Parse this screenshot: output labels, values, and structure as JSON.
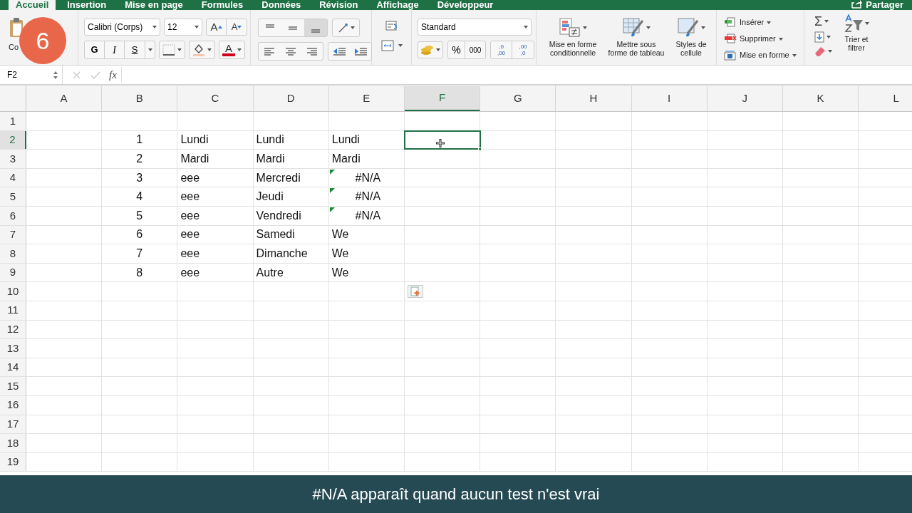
{
  "ribbon_tabs": [
    {
      "label": "Accueil",
      "selected": true
    },
    {
      "label": "Insertion",
      "selected": false
    },
    {
      "label": "Mise en page",
      "selected": false
    },
    {
      "label": "Formules",
      "selected": false
    },
    {
      "label": "Données",
      "selected": false
    },
    {
      "label": "Révision",
      "selected": false
    },
    {
      "label": "Affichage",
      "selected": false
    },
    {
      "label": "Développeur",
      "selected": false
    }
  ],
  "share_button": "Partager",
  "clipboard": {
    "paste_label": "Co"
  },
  "font": {
    "name": "Calibri (Corps)",
    "size": "12",
    "grow": "A",
    "shrink": "A",
    "bold": "G",
    "italic": "I",
    "underline": "S",
    "color_letter": "A"
  },
  "number": {
    "format": "Standard",
    "percent": "%",
    "thousands": "000",
    "increase_decimal": ",0\n,00",
    "decrease_decimal": ",00\n,0"
  },
  "styles": [
    {
      "label": "Mise en forme\nconditionnelle",
      "kind": "conditional"
    },
    {
      "label": "Mettre sous\nforme de tableau",
      "kind": "table"
    },
    {
      "label": "Styles de\ncellule",
      "kind": "cell"
    }
  ],
  "cells_group": [
    {
      "label": "Insérer",
      "kind": "insert"
    },
    {
      "label": "Supprimer",
      "kind": "delete"
    },
    {
      "label": "Mise en forme",
      "kind": "format"
    }
  ],
  "editing": {
    "sigma": "Σ",
    "sort_label": "Trier et\nfiltrer"
  },
  "formula_bar": {
    "name_box": "F2",
    "fx": "fx"
  },
  "grid": {
    "columns": [
      {
        "label": "A",
        "selected": false
      },
      {
        "label": "B",
        "selected": false
      },
      {
        "label": "C",
        "selected": false
      },
      {
        "label": "D",
        "selected": false
      },
      {
        "label": "E",
        "selected": false
      },
      {
        "label": "F",
        "selected": true
      },
      {
        "label": "G",
        "selected": false
      },
      {
        "label": "H",
        "selected": false
      },
      {
        "label": "I",
        "selected": false
      },
      {
        "label": "J",
        "selected": false
      },
      {
        "label": "K",
        "selected": false
      },
      {
        "label": "L",
        "selected": false
      }
    ],
    "rows": [
      {
        "label": "1",
        "selected": false,
        "cells": []
      },
      {
        "label": "2",
        "selected": true,
        "cells": [
          {},
          {
            "kind": "number",
            "text": "1"
          },
          {
            "kind": "text",
            "text": "Lundi"
          },
          {
            "kind": "text",
            "text": "Lundi"
          },
          {
            "kind": "text",
            "text": "Lundi"
          }
        ]
      },
      {
        "label": "3",
        "selected": false,
        "cells": [
          {},
          {
            "kind": "number",
            "text": "2"
          },
          {
            "kind": "text",
            "text": "Mardi"
          },
          {
            "kind": "text",
            "text": "Mardi"
          },
          {
            "kind": "text",
            "text": "Mardi"
          }
        ]
      },
      {
        "label": "4",
        "selected": false,
        "cells": [
          {},
          {
            "kind": "number",
            "text": "3"
          },
          {
            "kind": "text",
            "text": "eee"
          },
          {
            "kind": "text",
            "text": "Mercredi"
          },
          {
            "kind": "error",
            "text": "#N/A"
          }
        ]
      },
      {
        "label": "5",
        "selected": false,
        "cells": [
          {},
          {
            "kind": "number",
            "text": "4"
          },
          {
            "kind": "text",
            "text": "eee"
          },
          {
            "kind": "text",
            "text": "Jeudi"
          },
          {
            "kind": "error",
            "text": "#N/A"
          }
        ]
      },
      {
        "label": "6",
        "selected": false,
        "cells": [
          {},
          {
            "kind": "number",
            "text": "5"
          },
          {
            "kind": "text",
            "text": "eee"
          },
          {
            "kind": "text",
            "text": "Vendredi"
          },
          {
            "kind": "error",
            "text": "#N/A"
          }
        ]
      },
      {
        "label": "7",
        "selected": false,
        "cells": [
          {},
          {
            "kind": "number",
            "text": "6"
          },
          {
            "kind": "text",
            "text": "eee"
          },
          {
            "kind": "text",
            "text": "Samedi"
          },
          {
            "kind": "text",
            "text": "We"
          }
        ]
      },
      {
        "label": "8",
        "selected": false,
        "cells": [
          {},
          {
            "kind": "number",
            "text": "7"
          },
          {
            "kind": "text",
            "text": "eee"
          },
          {
            "kind": "text",
            "text": "Dimanche"
          },
          {
            "kind": "text",
            "text": "We"
          }
        ]
      },
      {
        "label": "9",
        "selected": false,
        "cells": [
          {},
          {
            "kind": "number",
            "text": "8"
          },
          {
            "kind": "text",
            "text": "eee"
          },
          {
            "kind": "text",
            "text": "Autre"
          },
          {
            "kind": "text",
            "text": "We"
          }
        ]
      },
      {
        "label": "10",
        "selected": false,
        "cells": [
          {},
          {},
          {},
          {},
          {},
          {
            "kind": "paste_options"
          }
        ]
      },
      {
        "label": "11",
        "selected": false,
        "cells": []
      },
      {
        "label": "12",
        "selected": false,
        "cells": []
      },
      {
        "label": "13",
        "selected": false,
        "cells": []
      },
      {
        "label": "14",
        "selected": false,
        "cells": []
      },
      {
        "label": "15",
        "selected": false,
        "cells": []
      },
      {
        "label": "16",
        "selected": false,
        "cells": []
      },
      {
        "label": "17",
        "selected": false,
        "cells": []
      },
      {
        "label": "18",
        "selected": false,
        "cells": []
      },
      {
        "label": "19",
        "selected": false,
        "cells": []
      }
    ]
  },
  "step_badge": "6",
  "caption": "#N/A apparaît quand aucun test n'est vrai"
}
